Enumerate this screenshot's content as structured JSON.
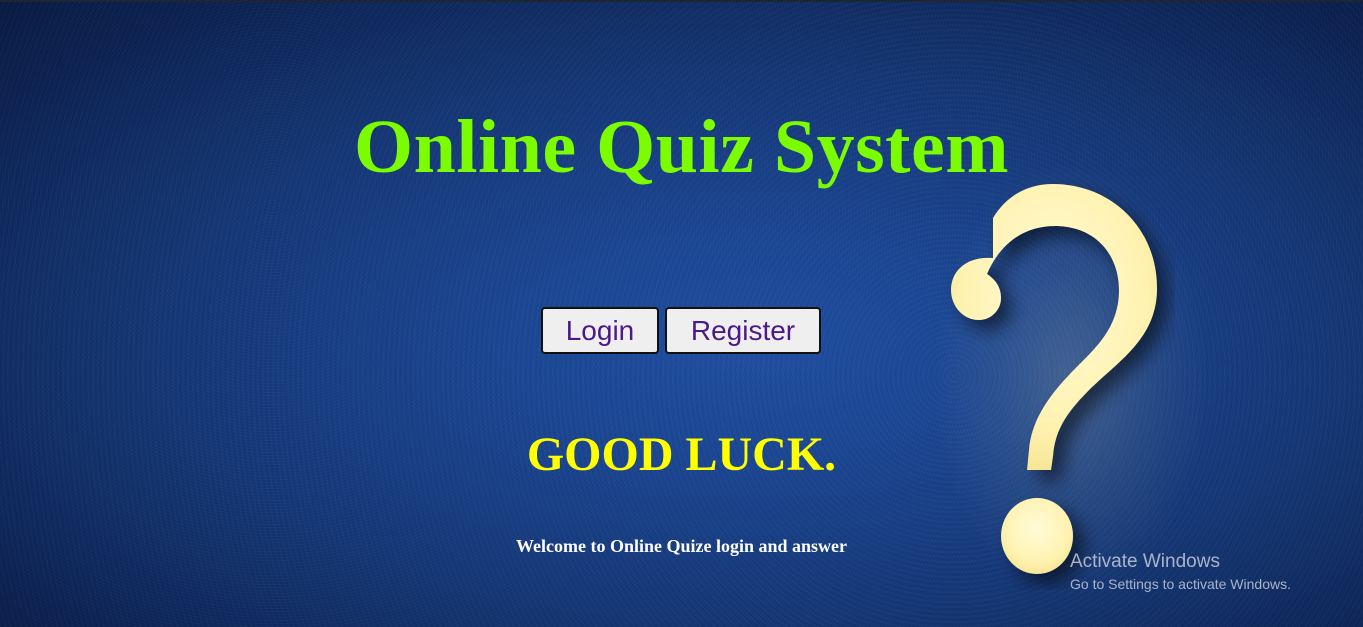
{
  "page": {
    "title": "Online Quiz System",
    "login_label": "Login",
    "register_label": "Register",
    "good_luck": "GOOD LUCK.",
    "welcome": "Welcome to Online Quize login and answer"
  },
  "decor": {
    "question_mark_icon": "question-mark-icon"
  },
  "watermark": {
    "title": "Activate Windows",
    "subtitle": "Go to Settings to activate Windows."
  },
  "colors": {
    "background": "#19438f",
    "title": "#7cfc00",
    "good_luck": "#ffff00",
    "button_text": "#4b1a86",
    "button_bg": "#efefef",
    "question_mark": "#fff4b8"
  }
}
